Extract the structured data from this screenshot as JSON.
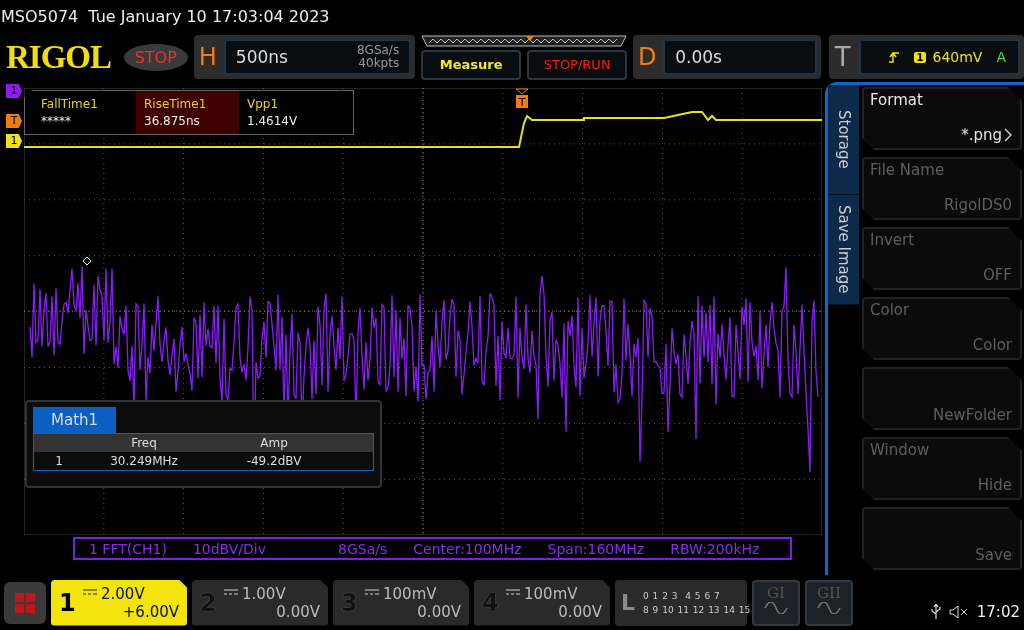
{
  "title_bar": {
    "model": "MSO5074",
    "datetime": "Tue January 10 17:03:04 2023"
  },
  "toolbar": {
    "logo": "RIGOL",
    "run_state": "STOP",
    "horizontal": {
      "label": "H",
      "timebase": "500ns",
      "sample_rate": "8GSa/s",
      "memory_depth": "40kpts"
    },
    "buttons": [
      {
        "label": "Measure",
        "kind": "measure"
      },
      {
        "label": "STOP/RUN",
        "kind": "run"
      }
    ],
    "delay": {
      "label": "D",
      "value": "0.00s"
    },
    "trigger": {
      "label": "T",
      "channel": "1",
      "level": "640mV",
      "mode": "A"
    }
  },
  "display": {
    "channel_markers": [
      {
        "label": "1",
        "color": "#8c1ef2"
      },
      {
        "label": "T",
        "color": "#f07c12"
      },
      {
        "label": "1",
        "color": "#f0e212"
      }
    ],
    "trigger_marker": "T",
    "measurements": [
      {
        "name": "FallTime1",
        "value": "*****",
        "selected": false
      },
      {
        "name": "RiseTime1",
        "value": "36.875ns",
        "selected": true
      },
      {
        "name": "Vpp1",
        "value": "1.4614V",
        "selected": false
      }
    ],
    "math_table": {
      "tab": "Math1",
      "columns": [
        "",
        "Freq",
        "Amp"
      ],
      "rows": [
        [
          "1",
          "30.249MHz",
          "-49.2dBV"
        ]
      ]
    },
    "fft_info": [
      "1 FFT(CH1)",
      "10dBV/Div",
      "8GSa/s",
      "Center:100MHz",
      "Span:160MHz",
      "RBW:200kHz"
    ]
  },
  "side_menu": {
    "tabs": [
      "Storage",
      "Save Image"
    ],
    "items": [
      {
        "label": "Format",
        "value": "*.png",
        "disabled": false,
        "submenu": true
      },
      {
        "label": "File Name",
        "value": "RigolDS0",
        "disabled": true,
        "submenu": false
      },
      {
        "label": "Invert",
        "value": "OFF",
        "disabled": true,
        "submenu": false
      },
      {
        "label": "Color",
        "value": "Color",
        "disabled": true,
        "submenu": false
      },
      {
        "value": "NewFolder",
        "disabled": true,
        "submenu": false
      },
      {
        "label": "Window",
        "value": "Hide",
        "disabled": true,
        "submenu": false
      },
      {
        "value": "Save",
        "disabled": true,
        "submenu": false
      }
    ]
  },
  "channels": [
    {
      "number": "1",
      "scale": "2.00V",
      "offset": "+6.00V",
      "selected": true
    },
    {
      "number": "2",
      "scale": "1.00V",
      "offset": "0.00V",
      "selected": false
    },
    {
      "number": "3",
      "scale": "100mV",
      "offset": "0.00V",
      "selected": false
    },
    {
      "number": "4",
      "scale": "100mV",
      "offset": "0.00V",
      "selected": false
    }
  ],
  "logic": {
    "label": "L",
    "rows": [
      "0 1 2 3  4 5 6 7",
      "8 9 10 11 12 13 14 15"
    ]
  },
  "generators": [
    "GI",
    "GII"
  ],
  "status": {
    "time": "17:02"
  }
}
